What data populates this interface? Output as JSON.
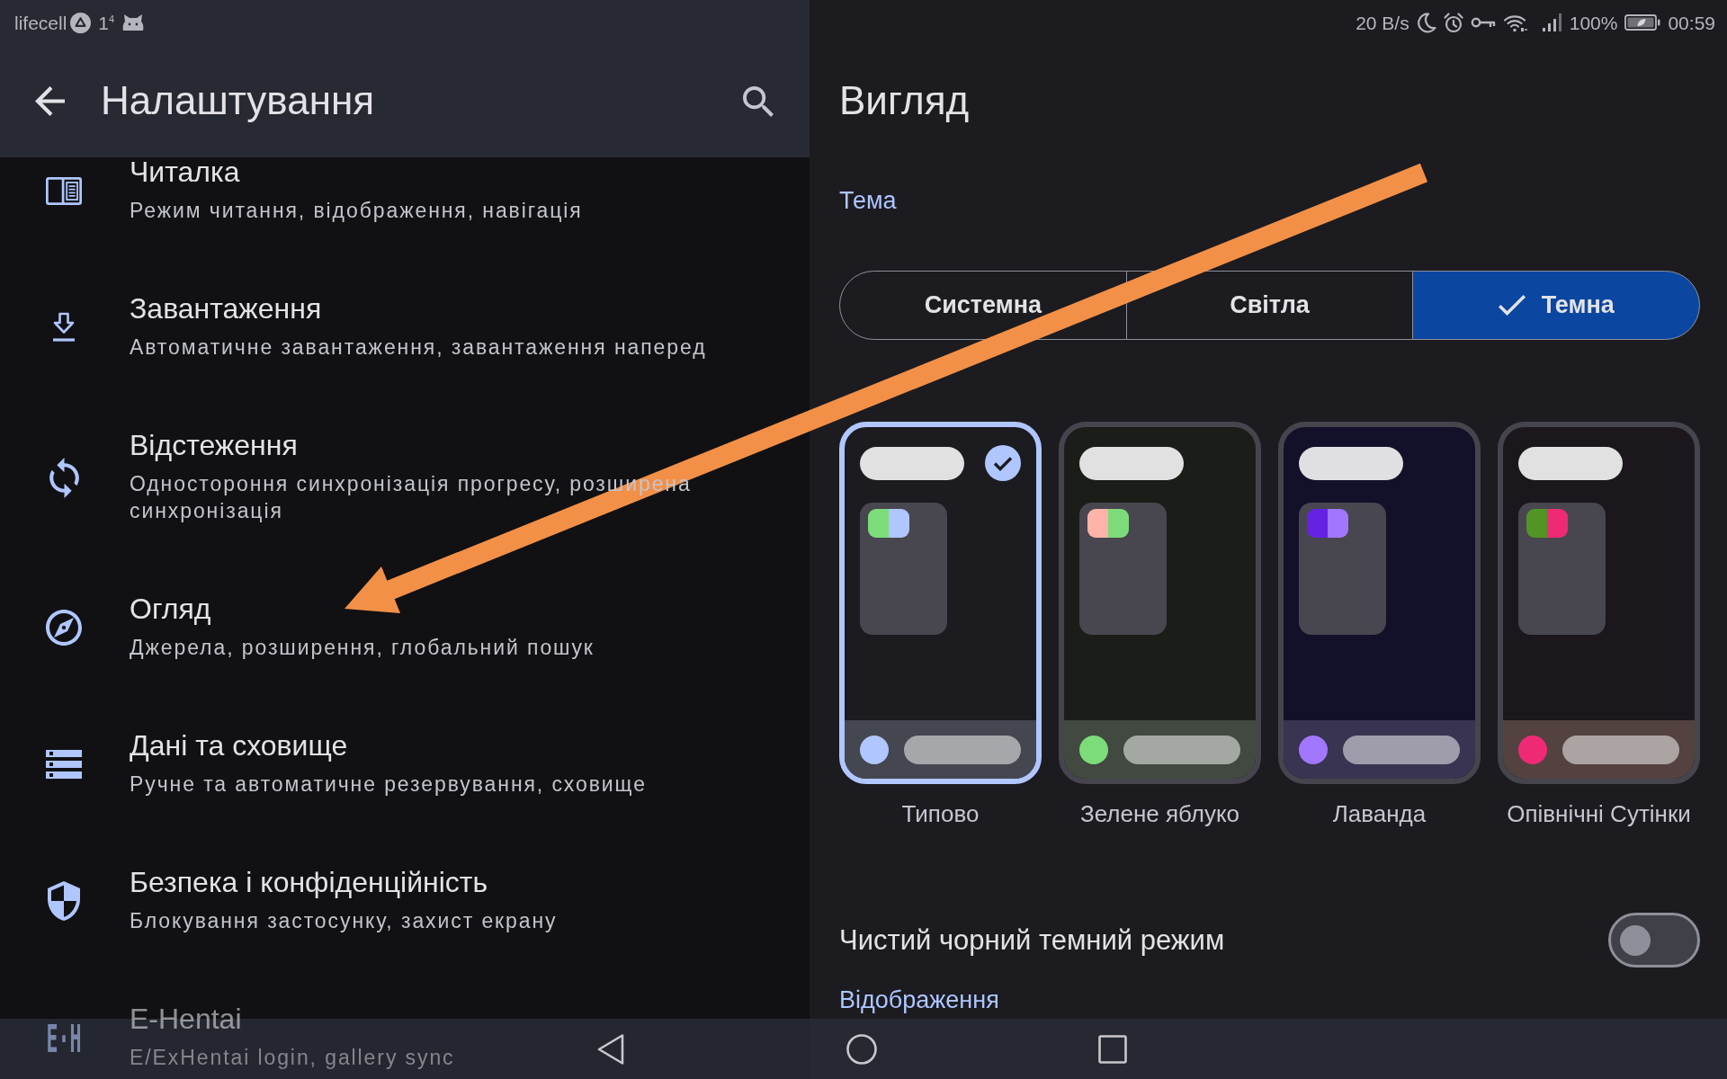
{
  "status_bar": {
    "carrier": "lifecell",
    "notification": "1$^{4}$",
    "network_speed": "20 B/s",
    "battery_percent": "100%",
    "time": "00:59"
  },
  "settings": {
    "title": "Налаштування",
    "items": [
      {
        "title": "Читалка",
        "subtitle": "Режим читання, відображення, навігація"
      },
      {
        "title": "Завантаження",
        "subtitle": "Автоматичне завантаження, завантаження наперед"
      },
      {
        "title": "Відстеження",
        "subtitle": "Одностороння синхронізація прогресу, розширена синхронізація"
      },
      {
        "title": "Огляд",
        "subtitle": "Джерела, розширення, глобальний пошук"
      },
      {
        "title": "Дані та сховище",
        "subtitle": "Ручне та автоматичне резервування, сховище"
      },
      {
        "title": "Безпека і конфіденційність",
        "subtitle": "Блокування застосунку, захист екрану"
      },
      {
        "title": "E-Hentai",
        "subtitle": "E/ExHentai login, gallery sync",
        "logo": "E·H"
      }
    ]
  },
  "appearance": {
    "title": "Вигляд",
    "section_title": "Тема",
    "modes": [
      {
        "label": "Системна",
        "selected": false
      },
      {
        "label": "Світла",
        "selected": false
      },
      {
        "label": "Темна",
        "selected": true
      }
    ],
    "themes": [
      {
        "label": "Типово",
        "selected": true,
        "ground": {
          "color": "#1b1b20"
        },
        "bar": {
          "color": "#44474f"
        },
        "color": "#b0c6ff",
        "swatch": [
          {
            "color": "#7ddc7a"
          },
          {
            "color": "#b0c6ff"
          }
        ]
      },
      {
        "label": "Зелене яблуко",
        "selected": false,
        "ground": {
          "color": "#1b1d19"
        },
        "bar": {
          "color": "#424940"
        },
        "color": "#7ddc7a",
        "swatch": [
          {
            "color": "#ffb4a9"
          },
          {
            "color": "#7ddc7a"
          }
        ]
      },
      {
        "label": "Лаванда",
        "selected": false,
        "ground": {
          "color": "#121129"
        },
        "bar": {
          "color": "#383451"
        },
        "color": "#a177ff",
        "swatch": [
          {
            "color": "#6522e3"
          },
          {
            "color": "#a177ff"
          }
        ]
      },
      {
        "label": "Опівнічні Сутінки",
        "selected": false,
        "ground": {
          "color": "#1b171c"
        },
        "bar": {
          "color": "#534240"
        },
        "color": "#ef2a74",
        "swatch": [
          {
            "color": "#529524"
          },
          {
            "color": "#ef2a74"
          }
        ]
      }
    ],
    "pure_black": {
      "label": "Чистий чорний темний режим",
      "on": false
    },
    "next_section_title": "Відображення"
  }
}
